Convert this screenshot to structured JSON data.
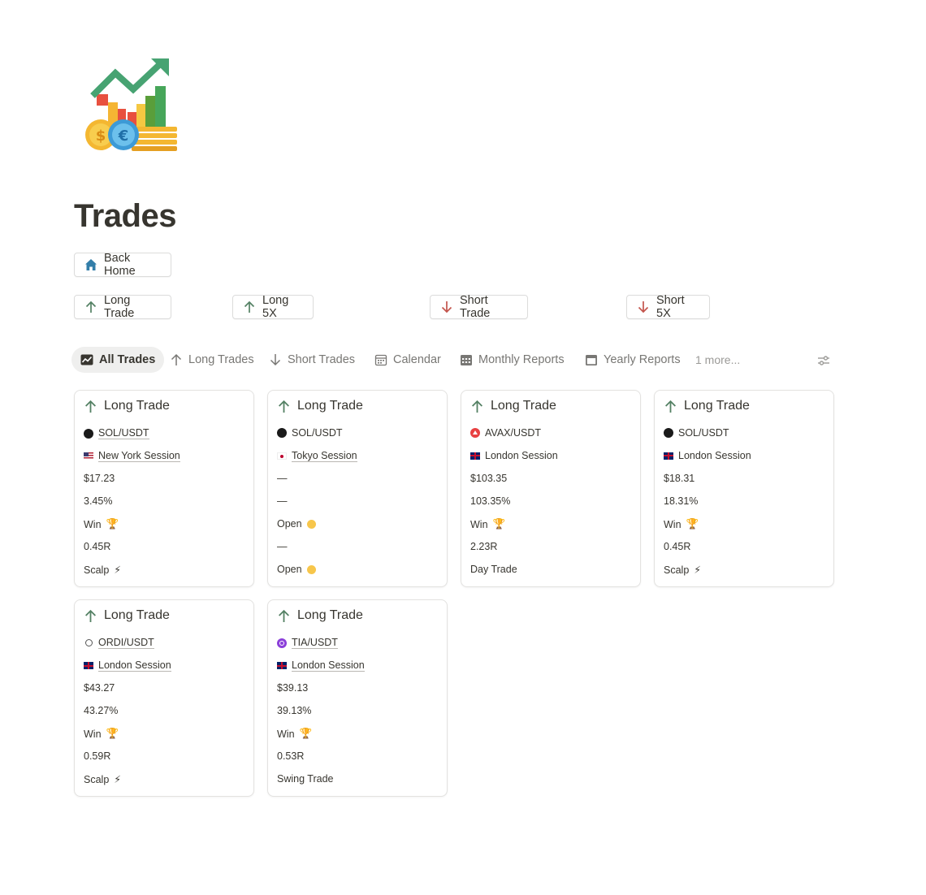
{
  "page": {
    "title": "Trades"
  },
  "buttons": {
    "back_home": "Back Home",
    "long_trade": "Long Trade",
    "long_5x": "Long 5X",
    "short_trade": "Short Trade",
    "short_5x": "Short 5X"
  },
  "tabs": {
    "all_trades": "All Trades",
    "long_trades": "Long Trades",
    "short_trades": "Short Trades",
    "calendar": "Calendar",
    "monthly_reports": "Monthly Reports",
    "yearly_reports": "Yearly Reports",
    "more": "1 more..."
  },
  "colors": {
    "green": "#548164",
    "red": "#c4554d",
    "orange": "#cc782f",
    "blue": "#487ca5",
    "purple": "#8a67ab",
    "text": "#37352f",
    "muted": "#787774"
  },
  "cards": [
    {
      "title": "Long Trade",
      "pair": "SOL/USDT",
      "coin_icon": "sol-icon",
      "session": "New York Session",
      "session_icon": "us-flag-icon",
      "pnl": "$17.23",
      "pct": "3.45%",
      "result": "Win",
      "result_icon": "trophy-icon",
      "r": "0.45R",
      "style": "Scalp",
      "style_icon": "lightning-icon"
    },
    {
      "title": "Long Trade",
      "pair": "SOL/USDT",
      "coin_icon": "sol-icon",
      "session": "Tokyo Session",
      "session_icon": "japan-flag-icon",
      "pnl": "—",
      "pct": "—",
      "result": "Open",
      "result_icon": "yellow-dot-icon",
      "r": "—",
      "style": "Open",
      "style_icon": "yellow-dot-icon"
    },
    {
      "title": "Long Trade",
      "pair": "AVAX/USDT",
      "coin_icon": "avax-icon",
      "session": "London Session",
      "session_icon": "uk-flag-icon",
      "pnl": "$103.35",
      "pct": "103.35%",
      "result": "Win",
      "result_icon": "trophy-icon",
      "r": "2.23R",
      "style": "Day Trade",
      "style_icon": ""
    },
    {
      "title": "Long Trade",
      "pair": "SOL/USDT",
      "coin_icon": "sol-icon",
      "session": "London Session",
      "session_icon": "uk-flag-icon",
      "pnl": "$18.31",
      "pct": "18.31%",
      "result": "Win",
      "result_icon": "trophy-icon",
      "r": "0.45R",
      "style": "Scalp",
      "style_icon": "lightning-icon"
    },
    {
      "title": "Long Trade",
      "pair": "ORDI/USDT",
      "coin_icon": "ordi-icon",
      "session": "London Session",
      "session_icon": "uk-flag-icon",
      "pnl": "$43.27",
      "pct": "43.27%",
      "result": "Win",
      "result_icon": "trophy-icon",
      "r": "0.59R",
      "style": "Scalp",
      "style_icon": "lightning-icon"
    },
    {
      "title": "Long Trade",
      "pair": "TIA/USDT",
      "coin_icon": "tia-icon",
      "session": "London Session",
      "session_icon": "uk-flag-icon",
      "pnl": "$39.13",
      "pct": "39.13%",
      "result": "Win",
      "result_icon": "trophy-icon",
      "r": "0.53R",
      "style": "Swing Trade",
      "style_icon": ""
    }
  ]
}
